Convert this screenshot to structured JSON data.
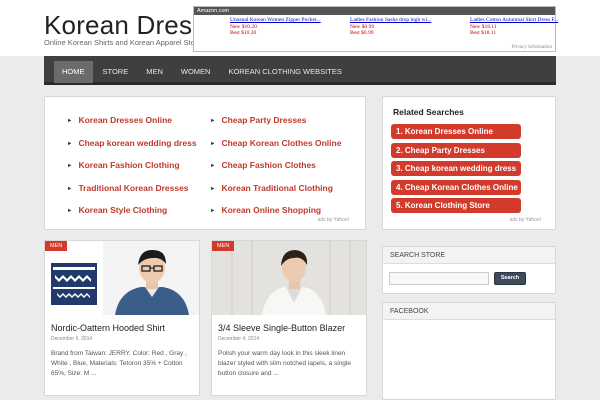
{
  "site": {
    "title": "Korean Dresses",
    "tagline": "Online Korean Shirts and Korean Apparel Store"
  },
  "ad_unit": {
    "header": "Amazon.com",
    "items": [
      {
        "title": "Unusual Korean Women Zipper Pocket...",
        "new_price": "New $10.20",
        "best_price": "Best $10.20"
      },
      {
        "title": "Ladies Fashion Sasha drop high wi...",
        "new_price": "New $0.99",
        "best_price": "Best $0.99"
      },
      {
        "title": "Ladies Cotton Autumnal Skirt Dress F...",
        "new_price": "New $18.11",
        "best_price": "Best $18.11"
      }
    ],
    "footer": "Privacy Information"
  },
  "nav": {
    "items": [
      {
        "label": "HOME",
        "active": true
      },
      {
        "label": "STORE",
        "active": false
      },
      {
        "label": "MEN",
        "active": false
      },
      {
        "label": "WOMEN",
        "active": false
      },
      {
        "label": "KOREAN CLOTHING WEBSITES",
        "active": false
      }
    ]
  },
  "link_units": {
    "col1": [
      "Korean Dresses Online",
      "Cheap korean wedding dress",
      "Korean Fashion Clothing",
      "Traditional Korean Dresses",
      "Korean Style Clothing"
    ],
    "col2": [
      "Cheap Party Dresses",
      "Cheap Korean Clothes Online",
      "Cheap Fashion Clothes",
      "Korean Traditional Clothing",
      "Korean Online Shopping"
    ],
    "bullet": "►",
    "ads_by": "ads by Yahoo!"
  },
  "related": {
    "title": "Related Searches",
    "items": [
      "1. Korean Dresses Online",
      "2. Cheap Party Dresses",
      "3. Cheap korean wedding dress",
      "4. Cheap Korean Clothes Online",
      "5. Korean Clothing Store"
    ],
    "ads_by": "ads by Yahoo!"
  },
  "posts": [
    {
      "tag": "MEN",
      "title": "Nordic-Oattern Hooded Shirt",
      "date": "December 6, 2014",
      "excerpt": "Brand from Taiwan: JERRY. Color: Red , Gray , White , Blue, Materials: Tetoron 35% + Cotton 65%, Size: M ..."
    },
    {
      "tag": "MEN",
      "title": "3/4 Sleeve Single-Button Blazer",
      "date": "December 4, 2014",
      "excerpt": "Polish your warm day look in this sleek linen blazer styled with slim notched lapels, a single button closure and ..."
    }
  ],
  "search_widget": {
    "title": "SEARCH STORE",
    "placeholder": "",
    "button": "Search"
  },
  "facebook_widget": {
    "title": "FACEBOOK"
  },
  "colors": {
    "accent": "#d23a2b",
    "nav": "#3f3f3f",
    "link": "#c0392b"
  }
}
